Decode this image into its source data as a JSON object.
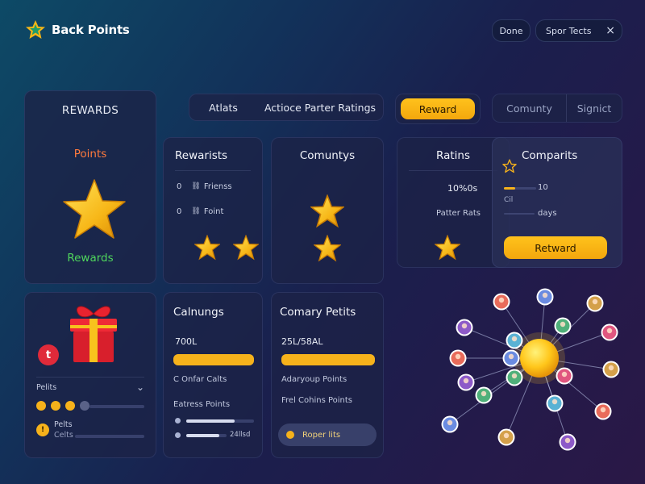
{
  "app": {
    "title": "Back Points"
  },
  "header": {
    "done_label": "Done",
    "spec_label": "Spor Tects",
    "close_icon": "×"
  },
  "tabs_main": [
    "Atlats",
    "Actioce Parter Ratings"
  ],
  "tabs_reward": {
    "active": "Reward"
  },
  "tabs_community": [
    "Comunty",
    "Signict"
  ],
  "rewards_card": {
    "title": "REWARDS",
    "points_label": "Points",
    "rewards_label": "Rewards"
  },
  "rewarists_card": {
    "title": "Rewarists",
    "rows": [
      {
        "num": "0",
        "label": "Frienss"
      },
      {
        "num": "0",
        "label": "Foint"
      }
    ]
  },
  "comuntys_card": {
    "title": "Comuntys"
  },
  "ratins_card": {
    "title": "Ratins",
    "value": "10%0s",
    "sub": "Patter Rats"
  },
  "comparits_card": {
    "title": "Comparits",
    "row1_value": "10",
    "row1_sub": "Cil",
    "row2_value": "days",
    "button_label": "Retward",
    "progress": 0.35
  },
  "gift_card": {
    "badge": "t",
    "points_label": "Pelits",
    "chevron": "⌄",
    "dots_filled": 3,
    "dots_total": 4,
    "item_label": "Pelts",
    "item_sub": "Celts"
  },
  "calnungs_card": {
    "title": "Calnungs",
    "amount": "700L",
    "row1": "C Onfar Calts",
    "row2": "Eatress Points",
    "row3_value": "24llsd",
    "progress_main": 1.0,
    "progress_a": 0.72,
    "progress_b": 0.82
  },
  "comary_card": {
    "title": "Comary Petits",
    "amount": "25L/58AL",
    "row1": "Adaryoup Points",
    "row2": "Frel Cohins Points",
    "chip_label": "Roper lits",
    "progress_main": 1.0
  },
  "colors": {
    "accent": "#f6b21b",
    "points_text": "#ff7a3d",
    "rewards_text": "#4fd65c",
    "badge_red": "#e02a3a"
  }
}
